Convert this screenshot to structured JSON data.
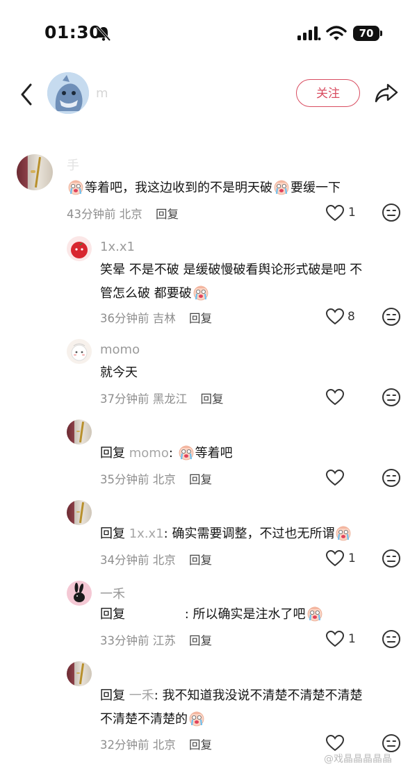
{
  "status_bar": {
    "time": "01:30",
    "battery": "70"
  },
  "header": {
    "username": "m",
    "follow_label": "关注"
  },
  "comments": [
    {
      "username": "  手",
      "text": "等着吧，我这边收到的不是明天破",
      "text_b": "要缓一下",
      "time": "43分钟前",
      "location": "北京",
      "reply": "回复",
      "likes": "1"
    },
    {
      "username": "1x.x1",
      "text_line1": "笑晕 不是不破 是缓破慢破看舆论形式破是吧 不",
      "text_line2": "管怎么破 都要破",
      "time": "36分钟前",
      "location": "吉林",
      "reply": "回复",
      "likes": "8"
    },
    {
      "username": "momo",
      "text": "就今天",
      "time": "37分钟前",
      "location": "黑龙江",
      "reply": "回复",
      "likes": ""
    },
    {
      "username": "",
      "reply_prefix": "回复 ",
      "reply_target": "momo",
      "text": ": ",
      "text_b": "等着吧",
      "time": "35分钟前",
      "location": "北京",
      "reply": "回复",
      "likes": ""
    },
    {
      "username": "",
      "reply_prefix": "回复 ",
      "reply_target": "1x.x1",
      "text": ": 确实需要调整，不过也无所谓",
      "time": "34分钟前",
      "location": "北京",
      "reply": "回复",
      "likes": "1"
    },
    {
      "username": "一禾",
      "reply_prefix": "回复 ",
      "reply_target": "",
      "text": ": 所以确实是注水了吧",
      "time": "33分钟前",
      "location": "江苏",
      "reply": "回复",
      "likes": "1"
    },
    {
      "username": "",
      "reply_prefix": "回复 ",
      "reply_target": "一禾",
      "text_line1": ": 我不知道我没说不清楚不清楚不清楚",
      "text_line2": "不清楚不清楚的",
      "time": "32分钟前",
      "location": "北京",
      "reply": "回复",
      "likes": ""
    }
  ],
  "watermark": "@戏晶晶晶晶晶",
  "colors": {
    "accent": "#d84b5f",
    "meta": "#8e8e8e"
  }
}
